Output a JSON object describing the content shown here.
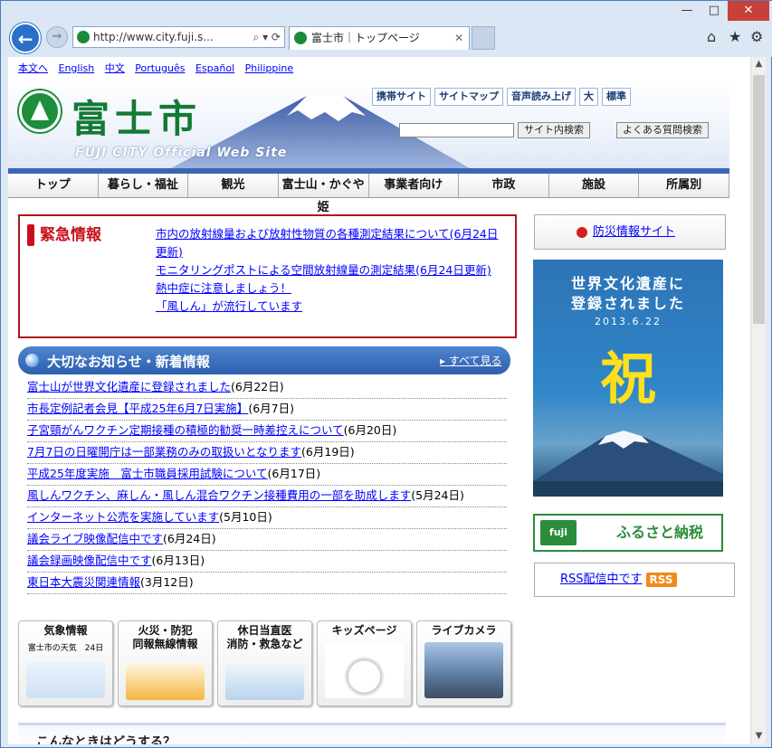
{
  "browser": {
    "address": "http://www.city.fuji.s...",
    "tab_title": "富士市｜トップページ",
    "tab_close": "✕",
    "window_min": "—",
    "window_max": "□",
    "window_close": "✕"
  },
  "lang_bar": [
    "本文へ",
    "English",
    "中文",
    "Português",
    "Español",
    "Philippine"
  ],
  "logo": {
    "title": "富士市",
    "subtitle": "FUJI CITY Official Web Site"
  },
  "util_buttons": [
    "携帯サイト",
    "サイトマップ",
    "音声読み上げ",
    "大",
    "標準"
  ],
  "search": {
    "site_button": "サイト内検索",
    "faq_button": "よくある質問検索"
  },
  "global_nav": [
    "トップ",
    "暮らし・福祉",
    "観光",
    "富士山・かぐや姫",
    "事業者向け",
    "市政",
    "施設",
    "所属別"
  ],
  "alert": {
    "title": "緊急情報",
    "links": [
      "市内の放射線量および放射性物質の各種測定結果について(6月24日更新)",
      "モニタリングポストによる空間放射線量の測定結果(6月24日更新)",
      "熱中症に注意しましょう！",
      "「風しん」が流行しています"
    ]
  },
  "news": {
    "title": "大切なお知らせ・新着情報",
    "see_all": "すべて見る",
    "items": [
      {
        "link": "富士山が世界文化遺産に登録されました",
        "date": "(6月22日)"
      },
      {
        "link": "市長定例記者会見【平成25年6月7日実施】",
        "date": "(6月7日)"
      },
      {
        "link": "子宮頸がんワクチン定期接種の積極的勧奨一時差控えについて",
        "date": "(6月20日)"
      },
      {
        "link": "7月7日の日曜開庁は一部業務のみの取扱いとなります",
        "date": "(6月19日)"
      },
      {
        "link": "平成25年度実施　富士市職員採用試験について",
        "date": "(6月17日)"
      },
      {
        "link": "風しんワクチン、麻しん・風しん混合ワクチン接種費用の一部を助成します",
        "date": "(5月24日)"
      },
      {
        "link": "インターネット公売を実施しています",
        "date": "(5月10日)"
      },
      {
        "link": "議会ライブ映像配信中です",
        "date": "(6月24日)"
      },
      {
        "link": "議会録画映像配信中です",
        "date": "(6月13日)"
      },
      {
        "link": "東日本大震災関連情報",
        "date": "(3月12日)"
      }
    ]
  },
  "banners": [
    {
      "title": "気象情報",
      "sub": "富士市の天気　24日"
    },
    {
      "title": "火災・防犯\n同報無線情報",
      "sub": ""
    },
    {
      "title": "休日当直医\n消防・救急など",
      "sub": ""
    },
    {
      "title": "キッズページ",
      "sub": ""
    },
    {
      "title": "ライブカメラ",
      "sub": ""
    }
  ],
  "bottom_heading": "こんなときはどうする？",
  "sidebar": {
    "disaster": "防災情報サイト",
    "heritage_line1": "世界文化遺産に",
    "heritage_line2": "登録されました",
    "heritage_date": "2013.6.22",
    "heritage_char": "祝",
    "furusato": "ふるさと納税",
    "furusato_mark": "fuji",
    "rss_text": "RSS配信中です",
    "rss_badge": "RSS"
  },
  "colors": {
    "accent": "#3a66b8",
    "alert": "#b0161d",
    "logo_green": "#137a35"
  }
}
